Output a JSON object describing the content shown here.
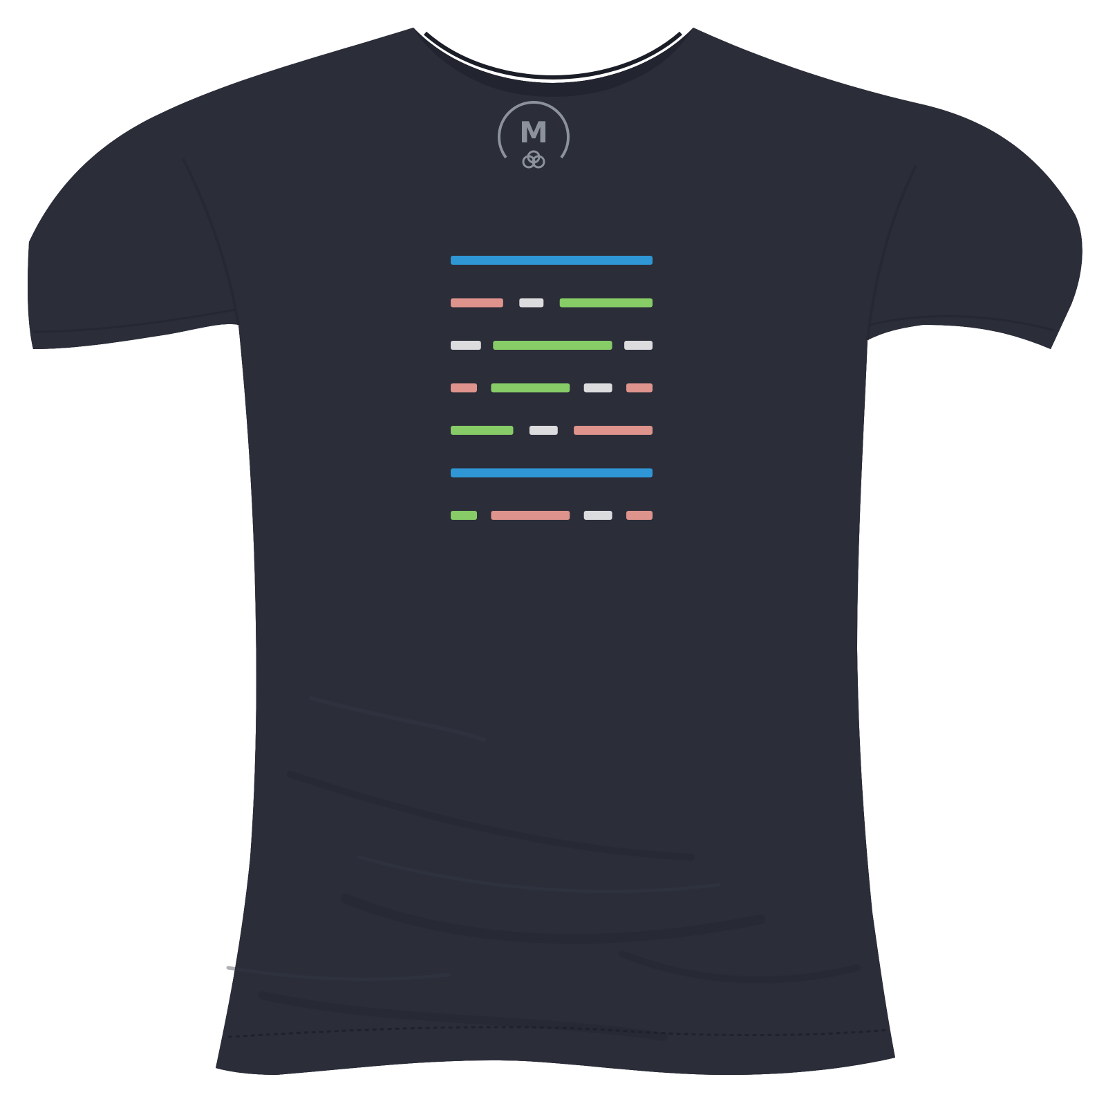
{
  "shirt": {
    "color": "#2b2d39",
    "neck_label": {
      "letter": "M",
      "color": "#8c929b"
    }
  },
  "print": {
    "palette": {
      "blue": "#2f9fe1",
      "green": "#8ed86a",
      "pink": "#ec9b92",
      "white": "#e9e9ec"
    },
    "rows": [
      [
        {
          "color": "blue",
          "length": 1.0
        }
      ],
      [
        {
          "color": "pink",
          "length": 0.26
        },
        {
          "color": "white",
          "length": 0.12
        },
        {
          "color": "green",
          "length": 0.46
        }
      ],
      [
        {
          "color": "white",
          "length": 0.15
        },
        {
          "color": "green",
          "length": 0.59
        },
        {
          "color": "white",
          "length": 0.14
        }
      ],
      [
        {
          "color": "pink",
          "length": 0.13
        },
        {
          "color": "green",
          "length": 0.39
        },
        {
          "color": "white",
          "length": 0.14
        },
        {
          "color": "pink",
          "length": 0.13
        }
      ],
      [
        {
          "color": "green",
          "length": 0.31
        },
        {
          "color": "white",
          "length": 0.14
        },
        {
          "color": "pink",
          "length": 0.39
        }
      ],
      [
        {
          "color": "blue",
          "length": 1.0
        }
      ],
      [
        {
          "color": "green",
          "length": 0.13
        },
        {
          "color": "pink",
          "length": 0.39
        },
        {
          "color": "white",
          "length": 0.14
        },
        {
          "color": "pink",
          "length": 0.13
        }
      ]
    ]
  }
}
